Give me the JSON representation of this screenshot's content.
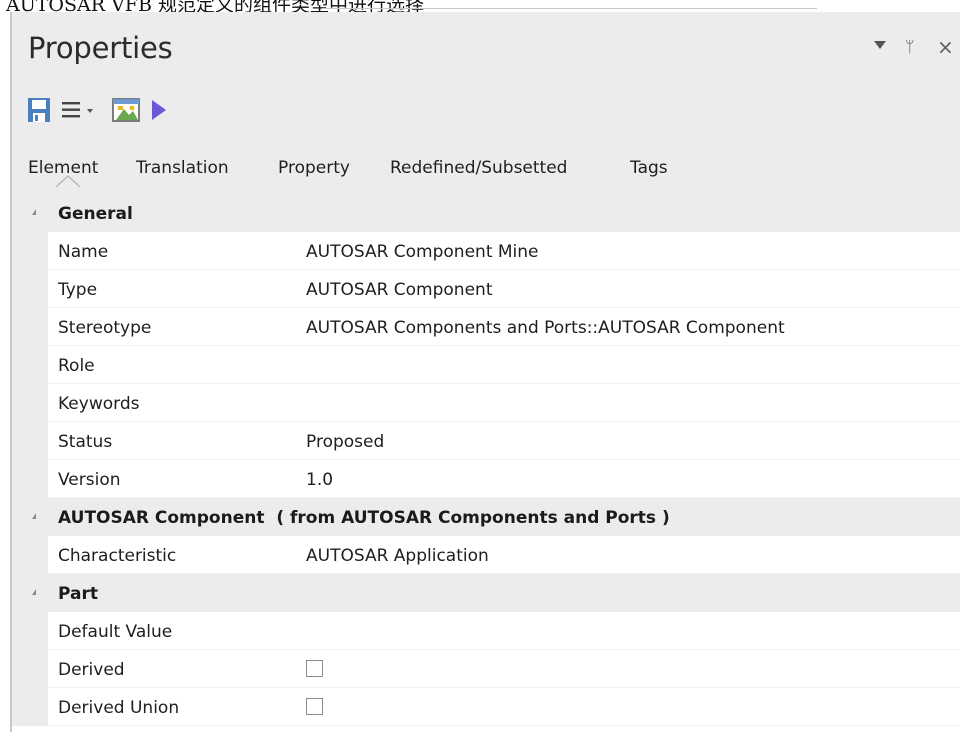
{
  "caption": {
    "text": "AUTOSAR VFB 规范定义的组件类型中进行选择"
  },
  "panel": {
    "title": "Properties",
    "window_controls": {
      "dropdown": "dropdown-arrow-icon",
      "pin": "ᛘ",
      "close": "×"
    }
  },
  "toolbar": {
    "icons": [
      "save-icon",
      "menu-icon",
      "properties-window-icon",
      "play-icon"
    ]
  },
  "tabs": [
    "Element",
    "Translation",
    "Property",
    "Redefined/Subsetted",
    "Tags"
  ],
  "grid": {
    "sections": [
      {
        "name": "General",
        "note": "",
        "rows": [
          {
            "label": "Name",
            "value": "AUTOSAR Component Mine"
          },
          {
            "label": "Type",
            "value": "AUTOSAR Component"
          },
          {
            "label": "Stereotype",
            "value": "AUTOSAR Components and Ports::AUTOSAR Component"
          },
          {
            "label": "Role",
            "value": ""
          },
          {
            "label": "Keywords",
            "value": ""
          },
          {
            "label": "Status",
            "value": "Proposed"
          },
          {
            "label": "Version",
            "value": "1.0"
          }
        ]
      },
      {
        "name": "AUTOSAR Component",
        "note": "( from AUTOSAR Components and Ports )",
        "rows": [
          {
            "label": "Characteristic",
            "value": "AUTOSAR Application"
          }
        ]
      },
      {
        "name": "Part",
        "note": "",
        "rows": [
          {
            "label": "Default Value",
            "value": ""
          },
          {
            "label": "Derived",
            "checked": false
          },
          {
            "label": "Derived Union",
            "checked": false
          }
        ]
      }
    ]
  },
  "colors": {
    "panel_bg": "#ececec",
    "grid_bg": "#ffffff",
    "save_icon": "#4a7fc1",
    "play_icon": "#6e55d8"
  }
}
